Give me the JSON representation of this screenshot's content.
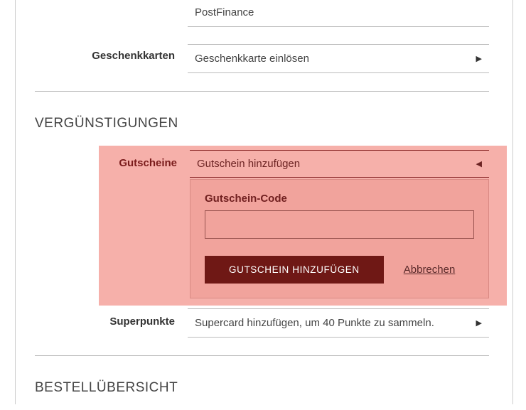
{
  "payment": {
    "option_postfinance": "PostFinance"
  },
  "giftcards": {
    "label": "Geschenkkarten",
    "redeem_label": "Geschenkkarte einlösen"
  },
  "discounts": {
    "section_title": "VERGÜNSTIGUNGEN",
    "vouchers": {
      "label": "Gutscheine",
      "add_label": "Gutschein hinzufügen",
      "code_label": "Gutschein-Code",
      "code_value": "",
      "submit_label": "GUTSCHEIN HINZUFÜGEN",
      "cancel_label": "Abbrechen"
    },
    "superpoints": {
      "label": "Superpunkte",
      "text": "Supercard hinzufügen, um 40 Punkte zu sammeln."
    }
  },
  "order_overview": {
    "section_title": "BESTELLÜBERSICHT"
  }
}
